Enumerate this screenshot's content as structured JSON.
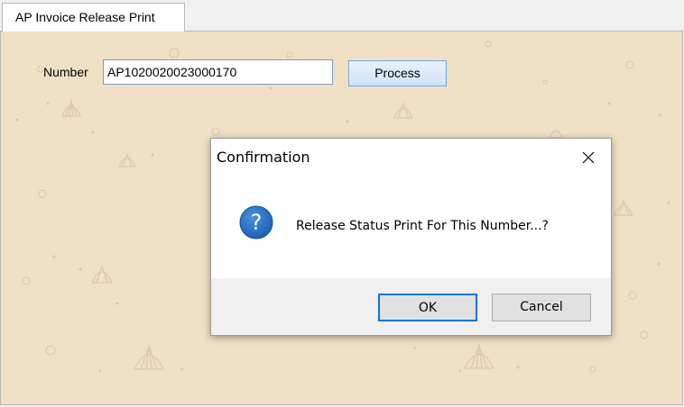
{
  "tab": {
    "label": "AP Invoice Release Print"
  },
  "form": {
    "number_label": "Number",
    "number_value": "AP1020020023000170",
    "process_label": "Process"
  },
  "dialog": {
    "title": "Confirmation",
    "message": "Release Status Print For This Number...?",
    "ok_label": "OK",
    "cancel_label": "Cancel",
    "icon": "question-icon",
    "close_icon": "close-icon"
  },
  "colors": {
    "panel_background": "#efe0c6",
    "accent": "#0078d7",
    "question_icon": "#1a5fb4"
  }
}
